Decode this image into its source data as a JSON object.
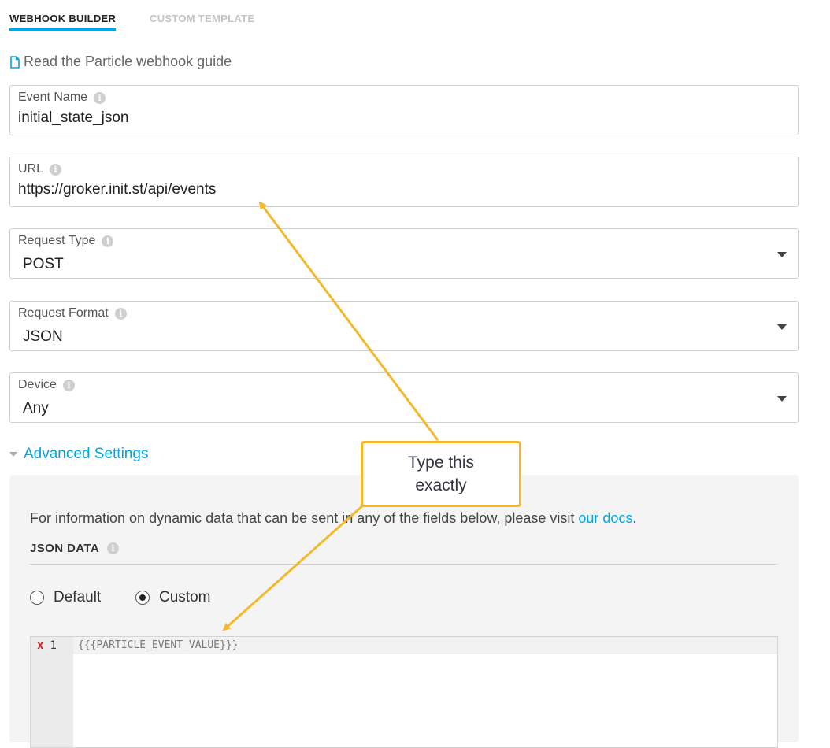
{
  "tabs": [
    {
      "label": "WEBHOOK BUILDER",
      "active": true
    },
    {
      "label": "CUSTOM TEMPLATE",
      "active": false
    }
  ],
  "guide_link": {
    "icon": "document-icon",
    "label": "Read the Particle webhook guide"
  },
  "fields": {
    "event_name": {
      "label": "Event Name",
      "value": "initial_state_json"
    },
    "url": {
      "label": "URL",
      "value": "https://groker.init.st/api/events"
    },
    "request_type": {
      "label": "Request Type",
      "value": "POST"
    },
    "request_format": {
      "label": "Request Format",
      "value": "JSON"
    },
    "device": {
      "label": "Device",
      "value": "Any"
    }
  },
  "advanced": {
    "label": "Advanced Settings",
    "help_text": "For information on dynamic data that can be sent in any of the fields below, please visit ",
    "help_link": "our docs",
    "help_end": ".",
    "json_data_title": "JSON DATA",
    "radio_default": "Default",
    "radio_custom": "Custom",
    "selected": "Custom",
    "editor": {
      "error_marker": "x",
      "line_number": "1",
      "code": "{{{PARTICLE_EVENT_VALUE}}}"
    }
  },
  "annotation": {
    "text": "Type this exactly",
    "color": "#f2b92a"
  },
  "colors": {
    "accent": "#00a6e0",
    "error": "#c62828"
  }
}
